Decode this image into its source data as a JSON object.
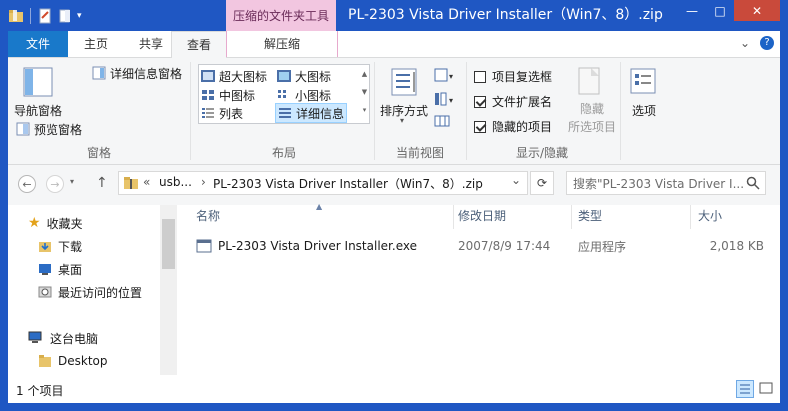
{
  "window": {
    "title": "PL-2303 Vista Driver Installer（Win7、8）.zip",
    "context_tab_header": "压缩的文件夹工具"
  },
  "controls": {
    "minimize": "—",
    "maximize": "□",
    "close": "✕"
  },
  "tabs": {
    "file": "文件",
    "home": "主页",
    "share": "共享",
    "view": "查看",
    "extract": "解压缩"
  },
  "ribbon": {
    "panes": {
      "nav_pane": "导航窗格",
      "preview_pane": "预览窗格",
      "details_pane": "详细信息窗格",
      "group_label": "窗格"
    },
    "layout": {
      "extra_large": "超大图标",
      "large": "大图标",
      "medium": "中图标",
      "small": "小图标",
      "list": "列表",
      "details": "详细信息",
      "group_label": "布局"
    },
    "current_view": {
      "sort_by": "排序方式",
      "group_label": "当前视图"
    },
    "show_hide": {
      "item_checkboxes": "项目复选框",
      "file_extensions": "文件扩展名",
      "hidden_items": "隐藏的项目",
      "hide_selected": "隐藏",
      "hide_selected_line2": "所选项目",
      "options": "选项",
      "group_label": "显示/隐藏",
      "item_checkboxes_checked": false,
      "file_extensions_checked": true,
      "hidden_items_checked": true
    }
  },
  "address": {
    "overflow": "«",
    "seg1": "usb...",
    "sep": "›",
    "seg2": "PL-2303 Vista Driver Installer（Win7、8）.zip",
    "dropdown": "⌄",
    "refresh": "⟳"
  },
  "search": {
    "placeholder": "搜索\"PL-2303 Vista Driver I..."
  },
  "nav_pane": {
    "favorites": "收藏夹",
    "downloads": "下载",
    "desktop": "桌面",
    "recent": "最近访问的位置",
    "this_pc": "这台电脑",
    "desktop2": "Desktop"
  },
  "columns": {
    "name": "名称",
    "modified": "修改日期",
    "type": "类型",
    "size": "大小"
  },
  "files": [
    {
      "name": "PL-2303 Vista Driver Installer.exe",
      "modified": "2007/8/9 17:44",
      "type": "应用程序",
      "size": "2,018 KB"
    }
  ],
  "status": {
    "count": "1 个项目"
  },
  "colors": {
    "titlebar": "#1f57c3",
    "file_tab": "#1979ca",
    "context_tab": "#f2c6e0",
    "close_button": "#c94a3b"
  }
}
